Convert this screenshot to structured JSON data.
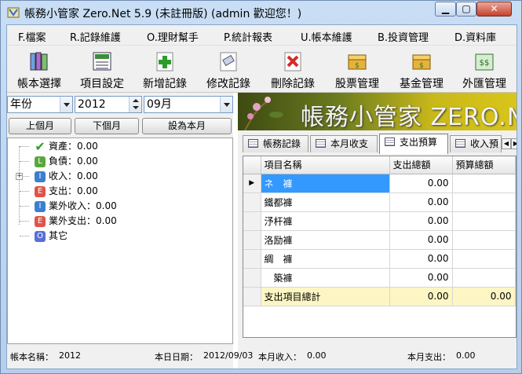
{
  "window": {
    "title": "帳務小管家 Zero.Net 5.9 (未註冊版) (admin 歡迎您！)"
  },
  "menu": [
    {
      "label": "F.檔案"
    },
    {
      "label": "R.記錄維護"
    },
    {
      "label": "O.理財幫手"
    },
    {
      "label": "P.統計報表"
    },
    {
      "label": "U.帳本維護"
    },
    {
      "label": "B.投資管理"
    },
    {
      "label": "D.資料庫"
    }
  ],
  "toolbar": [
    {
      "label": "帳本選擇",
      "icon": "books-icon"
    },
    {
      "label": "項目設定",
      "icon": "calculator-icon"
    },
    {
      "label": "新增記錄",
      "icon": "add-icon"
    },
    {
      "label": "修改記錄",
      "icon": "eraser-icon"
    },
    {
      "label": "刪除記錄",
      "icon": "delete-icon"
    },
    {
      "label": "股票管理",
      "icon": "stock-icon"
    },
    {
      "label": "基金管理",
      "icon": "fund-icon"
    },
    {
      "label": "外匯管理",
      "icon": "forex-icon"
    }
  ],
  "filters": {
    "period_type": "年份",
    "year": "2012",
    "month": "09月"
  },
  "nav_buttons": {
    "prev": "上個月",
    "next": "下個月",
    "set_current": "設為本月"
  },
  "tree": [
    {
      "label": "資產：0.00",
      "badge": "✔",
      "color": "#2aa12a"
    },
    {
      "label": "負債：0.00",
      "badge": "L",
      "color": "#5aa83c"
    },
    {
      "label": "收入：0.00",
      "badge": "I",
      "color": "#3b7fd0"
    },
    {
      "label": "支出：0.00",
      "badge": "E",
      "color": "#e0544a"
    },
    {
      "label": "業外收入：0.00",
      "badge": "I",
      "color": "#3b7fd0"
    },
    {
      "label": "業外支出：0.00",
      "badge": "E",
      "color": "#e0544a"
    },
    {
      "label": "其它",
      "badge": "O",
      "color": "#5a6fd6"
    }
  ],
  "banner": {
    "text": "帳務小管家 ZERO.NE"
  },
  "tabs": [
    {
      "label": "帳務記錄"
    },
    {
      "label": "本月收支"
    },
    {
      "label": "支出預算"
    },
    {
      "label": "收入預"
    }
  ],
  "grid": {
    "columns": [
      "項目名稱",
      "支出總額",
      "預算總額"
    ],
    "rows": [
      {
        "name": "ネ　褲",
        "spent": "0.00",
        "budget": ""
      },
      {
        "name": "鐵都褲",
        "spent": "0.00",
        "budget": ""
      },
      {
        "name": "汿杆褲",
        "spent": "0.00",
        "budget": ""
      },
      {
        "name": "洛励褲",
        "spent": "0.00",
        "budget": ""
      },
      {
        "name": "綢　褲",
        "spent": "0.00",
        "budget": ""
      },
      {
        "name": "　築褲",
        "spent": "0.00",
        "budget": ""
      }
    ],
    "total": {
      "name": "支出項目總計",
      "spent": "0.00",
      "budget": "0.00"
    }
  },
  "status": {
    "book_label": "帳本名稱：",
    "book_value": "2012",
    "date_label": "本日日期：",
    "date_value": "2012/09/03",
    "income_label": "本月收入：",
    "income_value": "0.00",
    "expense_label": "本月支出：",
    "expense_value": "0.00"
  },
  "colors": {
    "selection": "#3399ff",
    "total_row": "#fdf6c4",
    "window_frame": "#b6cfec"
  }
}
